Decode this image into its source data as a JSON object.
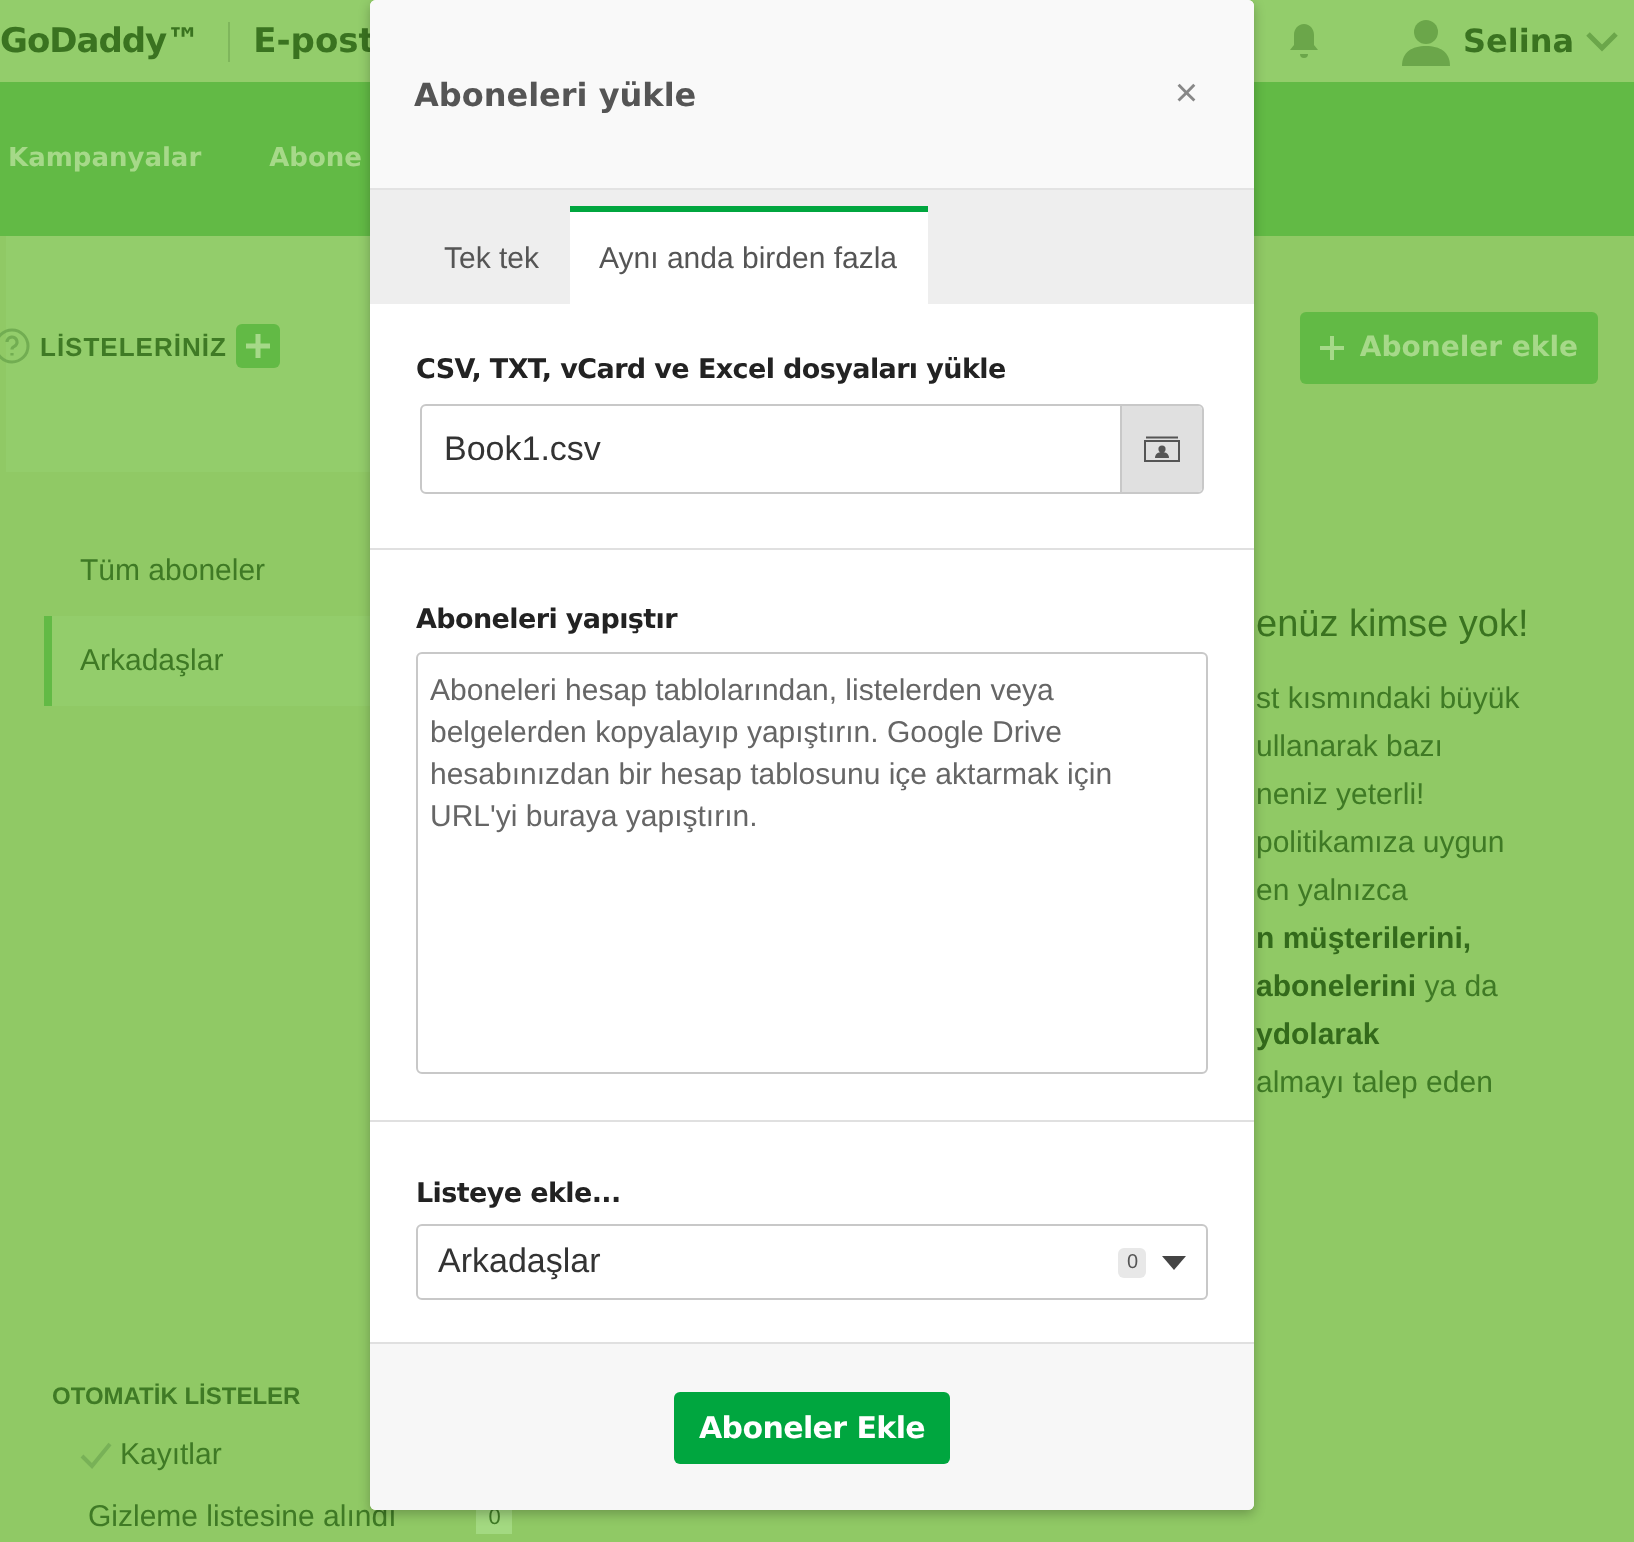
{
  "header": {
    "logo": "GoDaddy™",
    "product": "E-post",
    "user": "Selina"
  },
  "nav": {
    "items": [
      {
        "label": "Kampanyalar"
      },
      {
        "label": "Abone"
      }
    ]
  },
  "sidebar": {
    "title": "LİSTELERİNİZ",
    "lists": [
      {
        "label": "Tüm aboneler",
        "selected": false
      },
      {
        "label": "Arkadaşlar",
        "selected": true
      }
    ],
    "auto_title": "OTOMATİK LİSTELER",
    "auto_lists": [
      {
        "kind": "check",
        "label": "Kayıtlar"
      },
      {
        "kind": "hidden",
        "label": "Gizleme listesine alındı",
        "count": "0"
      }
    ]
  },
  "main": {
    "add_button": "Aboneler ekle",
    "empty_title": "enüz kimse yok!",
    "empty_lines": [
      "st kısmındaki büyük",
      "ullanarak bazı",
      "neniz yeterli!",
      "politikamıza uygun",
      "en yalnızca",
      "**n müşterilerini,**",
      "**abonelerini** ya da",
      "**ydolarak**",
      "almayı talep eden"
    ]
  },
  "dialog": {
    "title": "Aboneleri yükle",
    "close": "×",
    "tabs": [
      {
        "label": "Tek tek",
        "selected": false
      },
      {
        "label": "Aynı anda birden fazla",
        "selected": true
      }
    ],
    "file": {
      "label": "CSV, TXT, vCard ve Excel dosyaları yükle",
      "value": "Book1.csv"
    },
    "paste": {
      "label": "Aboneleri yapıştır",
      "placeholder": "Aboneleri hesap tablolarından, listelerden veya belgelerden kopyalayıp yapıştırın. Google Drive hesabınızdan bir hesap tablosunu içe aktarmak için URL'yi buraya yapıştırın."
    },
    "list": {
      "label": "Listeye ekle...",
      "value": "Arkadaşlar",
      "count": "0"
    },
    "submit": "Aboneler Ekle"
  }
}
